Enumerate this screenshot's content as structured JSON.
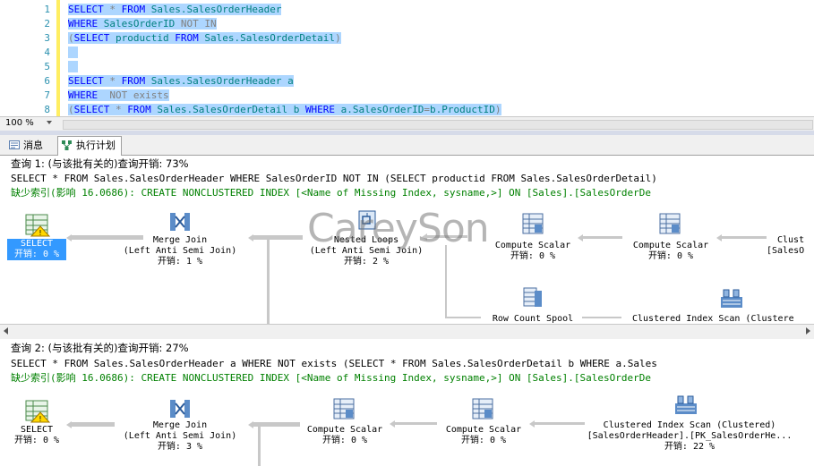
{
  "editor": {
    "lines": [
      {
        "n": "1",
        "parts": [
          {
            "t": "SELECT",
            "c": "kw"
          },
          {
            "t": " * ",
            "c": "op"
          },
          {
            "t": "FROM",
            "c": "kw"
          },
          {
            "t": " Sales.SalesOrderHeader",
            "c": "ob"
          }
        ]
      },
      {
        "n": "2",
        "parts": [
          {
            "t": "WHERE",
            "c": "kw"
          },
          {
            "t": " SalesOrderID ",
            "c": "ob"
          },
          {
            "t": "NOT IN",
            "c": "op"
          }
        ]
      },
      {
        "n": "3",
        "parts": [
          {
            "t": "(",
            "c": "op"
          },
          {
            "t": "SELECT",
            "c": "kw"
          },
          {
            "t": " productid ",
            "c": "ob"
          },
          {
            "t": "FROM",
            "c": "kw"
          },
          {
            "t": " Sales.SalesOrderDetail",
            "c": "ob"
          },
          {
            "t": ")",
            "c": "op"
          }
        ]
      },
      {
        "n": "4",
        "parts": []
      },
      {
        "n": "5",
        "parts": []
      },
      {
        "n": "6",
        "parts": [
          {
            "t": "SELECT",
            "c": "kw"
          },
          {
            "t": " * ",
            "c": "op"
          },
          {
            "t": "FROM",
            "c": "kw"
          },
          {
            "t": " Sales.SalesOrderHeader a",
            "c": "ob"
          }
        ]
      },
      {
        "n": "7",
        "parts": [
          {
            "t": "WHERE",
            "c": "kw"
          },
          {
            "t": "  NOT exists",
            "c": "op"
          }
        ]
      },
      {
        "n": "8",
        "parts": [
          {
            "t": "(",
            "c": "op"
          },
          {
            "t": "SELECT",
            "c": "kw"
          },
          {
            "t": " * ",
            "c": "op"
          },
          {
            "t": "FROM",
            "c": "kw"
          },
          {
            "t": " Sales.SalesOrderDetail b ",
            "c": "ob"
          },
          {
            "t": "WHERE",
            "c": "kw"
          },
          {
            "t": " a.SalesOrderID",
            "c": "ob"
          },
          {
            "t": "=",
            "c": "op"
          },
          {
            "t": "b.ProductID",
            "c": "ob"
          },
          {
            "t": ")",
            "c": "op"
          }
        ]
      }
    ]
  },
  "zoom": "100 %",
  "tabs": {
    "messages": "消息",
    "plan": "执行计划"
  },
  "watermark": "CareySon",
  "query1": {
    "title": "查询 1: (与该批有关的)查询开销: 73%",
    "sql": "SELECT * FROM Sales.SalesOrderHeader WHERE SalesOrderID NOT IN (SELECT productid FROM Sales.SalesOrderDetail)",
    "missing": "缺少索引(影响 16.0686): CREATE NONCLUSTERED INDEX [<Name of Missing Index, sysname,>] ON [Sales].[SalesOrderDe",
    "nodes": {
      "select": {
        "name": "SELECT",
        "cost": "开销: 0 %"
      },
      "merge": {
        "name": "Merge Join",
        "sub": "(Left Anti Semi Join)",
        "cost": "开销: 1 %"
      },
      "nested": {
        "name": "Nested Loops",
        "sub": "(Left Anti Semi Join)",
        "cost": "开销: 2 %"
      },
      "compute1": {
        "name": "Compute Scalar",
        "cost": "开销: 0 %"
      },
      "compute2": {
        "name": "Compute Scalar",
        "cost": "开销: 0 %"
      },
      "clust_right": {
        "name": "Clust",
        "sub": "[SalesO"
      },
      "rowcount": {
        "name": "Row Count Spool"
      },
      "clust_scan": {
        "name": "Clustered Index Scan (Clustere"
      }
    }
  },
  "query2": {
    "title": "查询 2: (与该批有关的)查询开销: 27%",
    "sql": "SELECT * FROM Sales.SalesOrderHeader a WHERE NOT exists (SELECT * FROM Sales.SalesOrderDetail b WHERE a.Sales",
    "missing": "缺少索引(影响 16.0686): CREATE NONCLUSTERED INDEX [<Name of Missing Index, sysname,>] ON [Sales].[SalesOrderDe",
    "nodes": {
      "select": {
        "name": "SELECT",
        "cost": "开销: 0 %"
      },
      "merge": {
        "name": "Merge Join",
        "sub": "(Left Anti Semi Join)",
        "cost": "开销: 3 %"
      },
      "compute1": {
        "name": "Compute Scalar",
        "cost": "开销: 0 %"
      },
      "compute2": {
        "name": "Compute Scalar",
        "cost": "开销: 0 %"
      },
      "clust_scan": {
        "name": "Clustered Index Scan (Clustered)",
        "sub": "[SalesOrderHeader].[PK_SalesOrderHe...",
        "cost": "开销: 22 %"
      }
    }
  },
  "colors": {
    "keyword": "#0000ff",
    "object": "#008080",
    "operator": "#808080",
    "selection": "#add6ff",
    "missing": "#008000",
    "selected_node": "#3399ff"
  }
}
